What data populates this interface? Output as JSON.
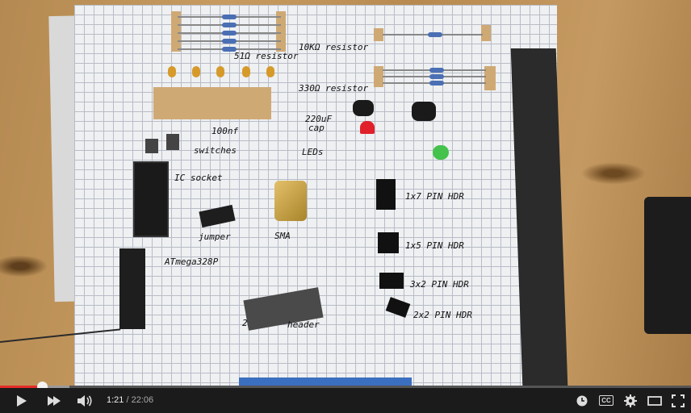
{
  "video": {
    "labels": {
      "r51": "51Ω resistor",
      "r10k": "10KΩ resistor",
      "r330": "330Ω resistor",
      "cap_100nf": "100nf",
      "cap_220uf_line1": "220uF",
      "cap_220uf_line2": "cap",
      "switches": "switches",
      "leds": "LEDs",
      "ic_socket": "IC socket",
      "jumper": "jumper",
      "sma": "SMA",
      "hdr_1x7": "1x7 PIN HDR",
      "hdr_1x5": "1x5 PIN HDR",
      "hdr_3x2": "3x2 PIN HDR",
      "hdr_2x2": "2x2 PIN HDR",
      "atmega": "ATmega328P",
      "header_prefix": "2",
      "header": "header"
    }
  },
  "player": {
    "current_time": "1:21",
    "separator": "/",
    "duration": "22:06",
    "progress_fraction": 0.061,
    "loaded_fraction": 0.1,
    "colors": {
      "played": "#e52d27",
      "bar_bg": "#1b1b1b"
    },
    "icons": {
      "play": "play-icon",
      "next": "next-icon",
      "volume": "volume-icon",
      "watch_later": "clock-icon",
      "captions": "cc-icon",
      "settings": "gear-icon",
      "theater": "theater-mode-icon",
      "fullscreen": "fullscreen-icon"
    },
    "cc_text": "CC"
  }
}
